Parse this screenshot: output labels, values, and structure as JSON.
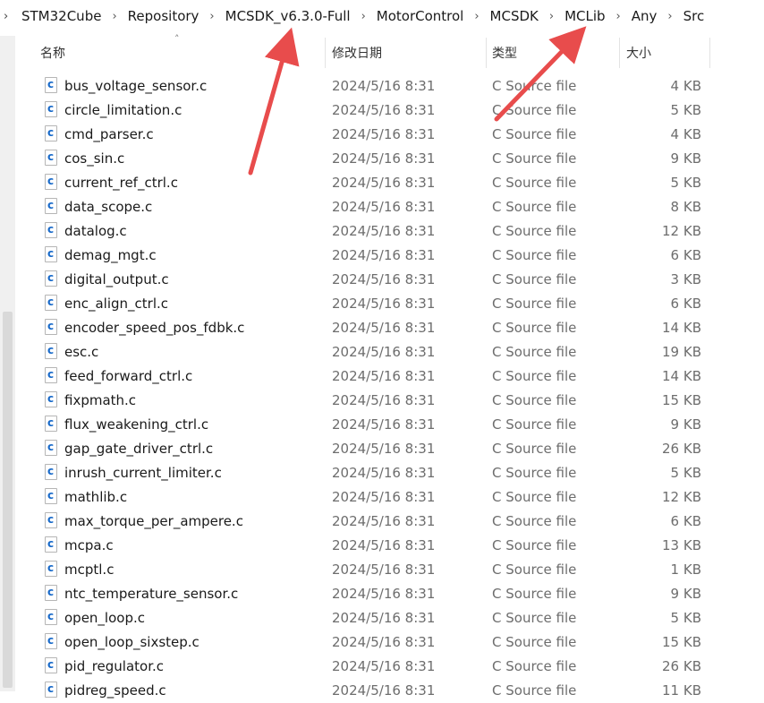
{
  "breadcrumb": [
    "STM32Cube",
    "Repository",
    "MCSDK_v6.3.0-Full",
    "MotorControl",
    "MCSDK",
    "MCLib",
    "Any",
    "Src"
  ],
  "columns": {
    "name": "名称",
    "date": "修改日期",
    "type": "类型",
    "size": "大小"
  },
  "files": [
    {
      "name": "bus_voltage_sensor.c",
      "date": "2024/5/16 8:31",
      "type": "C Source file",
      "size": "4 KB"
    },
    {
      "name": "circle_limitation.c",
      "date": "2024/5/16 8:31",
      "type": "C Source file",
      "size": "5 KB"
    },
    {
      "name": "cmd_parser.c",
      "date": "2024/5/16 8:31",
      "type": "C Source file",
      "size": "4 KB"
    },
    {
      "name": "cos_sin.c",
      "date": "2024/5/16 8:31",
      "type": "C Source file",
      "size": "9 KB"
    },
    {
      "name": "current_ref_ctrl.c",
      "date": "2024/5/16 8:31",
      "type": "C Source file",
      "size": "5 KB"
    },
    {
      "name": "data_scope.c",
      "date": "2024/5/16 8:31",
      "type": "C Source file",
      "size": "8 KB"
    },
    {
      "name": "datalog.c",
      "date": "2024/5/16 8:31",
      "type": "C Source file",
      "size": "12 KB"
    },
    {
      "name": "demag_mgt.c",
      "date": "2024/5/16 8:31",
      "type": "C Source file",
      "size": "6 KB"
    },
    {
      "name": "digital_output.c",
      "date": "2024/5/16 8:31",
      "type": "C Source file",
      "size": "3 KB"
    },
    {
      "name": "enc_align_ctrl.c",
      "date": "2024/5/16 8:31",
      "type": "C Source file",
      "size": "6 KB"
    },
    {
      "name": "encoder_speed_pos_fdbk.c",
      "date": "2024/5/16 8:31",
      "type": "C Source file",
      "size": "14 KB"
    },
    {
      "name": "esc.c",
      "date": "2024/5/16 8:31",
      "type": "C Source file",
      "size": "19 KB"
    },
    {
      "name": "feed_forward_ctrl.c",
      "date": "2024/5/16 8:31",
      "type": "C Source file",
      "size": "14 KB"
    },
    {
      "name": "fixpmath.c",
      "date": "2024/5/16 8:31",
      "type": "C Source file",
      "size": "15 KB"
    },
    {
      "name": "flux_weakening_ctrl.c",
      "date": "2024/5/16 8:31",
      "type": "C Source file",
      "size": "9 KB"
    },
    {
      "name": "gap_gate_driver_ctrl.c",
      "date": "2024/5/16 8:31",
      "type": "C Source file",
      "size": "26 KB"
    },
    {
      "name": "inrush_current_limiter.c",
      "date": "2024/5/16 8:31",
      "type": "C Source file",
      "size": "5 KB"
    },
    {
      "name": "mathlib.c",
      "date": "2024/5/16 8:31",
      "type": "C Source file",
      "size": "12 KB"
    },
    {
      "name": "max_torque_per_ampere.c",
      "date": "2024/5/16 8:31",
      "type": "C Source file",
      "size": "6 KB"
    },
    {
      "name": "mcpa.c",
      "date": "2024/5/16 8:31",
      "type": "C Source file",
      "size": "13 KB"
    },
    {
      "name": "mcptl.c",
      "date": "2024/5/16 8:31",
      "type": "C Source file",
      "size": "1 KB"
    },
    {
      "name": "ntc_temperature_sensor.c",
      "date": "2024/5/16 8:31",
      "type": "C Source file",
      "size": "9 KB"
    },
    {
      "name": "open_loop.c",
      "date": "2024/5/16 8:31",
      "type": "C Source file",
      "size": "5 KB"
    },
    {
      "name": "open_loop_sixstep.c",
      "date": "2024/5/16 8:31",
      "type": "C Source file",
      "size": "15 KB"
    },
    {
      "name": "pid_regulator.c",
      "date": "2024/5/16 8:31",
      "type": "C Source file",
      "size": "26 KB"
    },
    {
      "name": "pidreg_speed.c",
      "date": "2024/5/16 8:31",
      "type": "C Source file",
      "size": "11 KB"
    }
  ],
  "colors": {
    "annotation_arrow": "#e84c4c",
    "icon_accent": "#1769c9"
  },
  "icons": {
    "file": "c-source-file-icon",
    "separator": "chevron-right-icon",
    "sort": "chevron-up-icon"
  }
}
